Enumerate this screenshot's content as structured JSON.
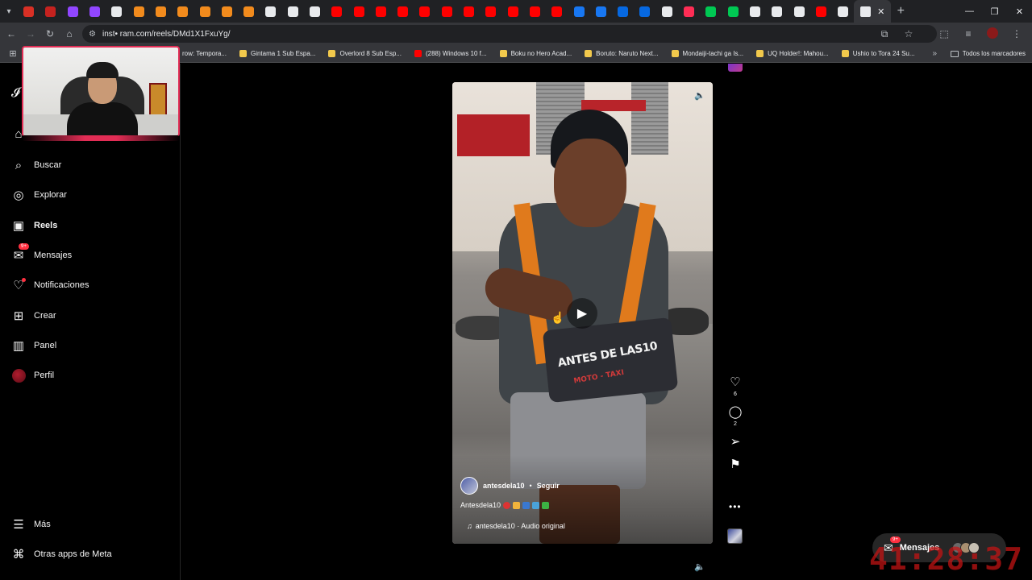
{
  "browser": {
    "url": "inst• ram.com/reels/DMd1X1FxuYg/",
    "tab_favicon_colors": [
      "#d93025",
      "#c5221f",
      "#9146ff",
      "#9146ff",
      "#e8eaed",
      "#f28b1d",
      "#f28b1d",
      "#f28b1d",
      "#f28b1d",
      "#f28b1d",
      "#f28b1d",
      "#e8eaed",
      "#e8eaed",
      "#e8eaed",
      "#ff0000",
      "#ff0000",
      "#ff0000",
      "#ff0000",
      "#ff0000",
      "#ff0000",
      "#ff0000",
      "#ff0000",
      "#ff0000",
      "#ff0000",
      "#ff0000",
      "#1877f2",
      "#1877f2",
      "#0668e1",
      "#0668e1",
      "#e8eaed",
      "#ff2d55",
      "#00c853",
      "#00c853",
      "#e8eaed",
      "#e8eaed",
      "#e8eaed",
      "#ff0000",
      "#e8eaed"
    ]
  },
  "bookmarks": {
    "items": [
      "row: Tempora...",
      "Gintama 1 Sub Espa...",
      "Overlord 8 Sub Esp...",
      "(288) Windows 10 f...",
      "Boku no Hero Acad...",
      "Boruto: Naruto Next...",
      "Mondaiji-tachi ga Is...",
      "UQ Holder!: Mahou...",
      "Ushio to Tora 24 Su..."
    ],
    "all_label": "Todos los marcadores"
  },
  "sidebar": {
    "items": [
      {
        "label": "Buscar",
        "icon": "search-icon"
      },
      {
        "label": "Explorar",
        "icon": "compass-icon"
      },
      {
        "label": "Reels",
        "icon": "reels-icon"
      },
      {
        "label": "Mensajes",
        "icon": "messenger-icon",
        "badge": "9+"
      },
      {
        "label": "Notificaciones",
        "icon": "heart-icon"
      },
      {
        "label": "Crear",
        "icon": "plus-square-icon"
      },
      {
        "label": "Panel",
        "icon": "bar-chart-icon"
      },
      {
        "label": "Perfil",
        "icon": "avatar"
      }
    ],
    "bottom": [
      {
        "label": "Más",
        "icon": "menu-icon"
      },
      {
        "label": "Otras apps de Meta",
        "icon": "meta-apps-icon"
      }
    ]
  },
  "reel": {
    "sign_text": "ANTES DE LAS10",
    "sign_sub": "MOTO - TAXI",
    "username": "antesdela10",
    "follow": "Seguir",
    "separator": "•",
    "caption": "Antesdela10",
    "audio": "antesdela10 · Audio original",
    "likes": "6",
    "comments": "2"
  },
  "messages_pill": {
    "label": "Mensajes",
    "badge": "9+"
  },
  "overlay_clock": "41:28:37"
}
